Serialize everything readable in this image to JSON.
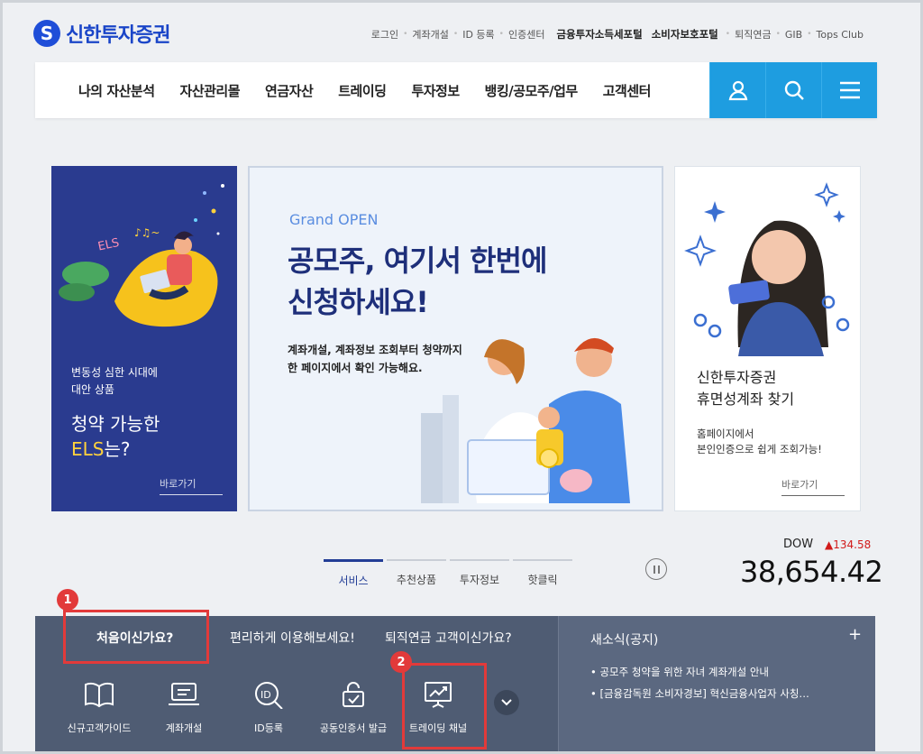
{
  "header": {
    "logo_mark": "S",
    "logo_text": "신한투자증권",
    "util_links": [
      "로그인",
      "계좌개설",
      "ID 등록",
      "인증센터"
    ],
    "util_strong": [
      "금융투자소득세포털",
      "소비자보호포털"
    ],
    "util_extra": [
      "퇴직연금",
      "GIB",
      "Tops Club"
    ]
  },
  "gnb": {
    "menu": [
      "나의 자산분석",
      "자산관리몰",
      "연금자산",
      "트레이딩",
      "투자정보",
      "뱅킹/공모주/업무",
      "고객센터"
    ],
    "icons": [
      "user-icon",
      "search-icon",
      "menu-icon"
    ],
    "accent": "#1e9de0"
  },
  "banners": {
    "left": {
      "sub": [
        "변동성 심한 시대에",
        "대안 상품"
      ],
      "main_line1": "청약 가능한",
      "main_els": "ELS",
      "main_suffix": "는?",
      "link": "바로가기",
      "deco_text": "ELS",
      "bg": "#2a3b8f"
    },
    "center": {
      "open": "Grand OPEN",
      "title": [
        "공모주, 여기서 한번에",
        "신청하세요!"
      ],
      "desc": [
        "계좌개설, 계좌정보 조회부터 청약까지",
        "한 페이지에서 확인 가능해요."
      ]
    },
    "right": {
      "title": [
        "신한투자증권",
        "휴면성계좌 찾기"
      ],
      "desc": [
        "홈페이지에서",
        "본인인증으로 쉽게 조회가능!"
      ],
      "link": "바로가기"
    }
  },
  "tabs": [
    {
      "label": "서비스",
      "active": true
    },
    {
      "label": "추천상품",
      "active": false
    },
    {
      "label": "투자정보",
      "active": false
    },
    {
      "label": "핫클릭",
      "active": false
    }
  ],
  "index": {
    "name": "DOW",
    "change": "▲134.58",
    "value": "38,654.42",
    "up_color": "#d11a1a"
  },
  "panel": {
    "questions": [
      "처음이신가요?",
      "편리하게 이용해보세요!",
      "퇴직연금 고객이신가요?"
    ],
    "services": [
      {
        "icon": "book-icon",
        "label": "신규고객가이드"
      },
      {
        "icon": "laptop-icon",
        "label": "계좌개설"
      },
      {
        "icon": "id-search-icon",
        "label": "ID등록"
      },
      {
        "icon": "certificate-lock-icon",
        "label": "공동인증서 발급"
      },
      {
        "icon": "trading-chart-icon",
        "label": "트레이딩 채널"
      }
    ],
    "more_icon": "chevron-down-icon"
  },
  "news": {
    "title": "새소식(공지)",
    "plus": "+",
    "items": [
      "공모주 청약을 위한 자녀 계좌개설 안내",
      "[금융감독원 소비자경보] 혁신금융사업자 사칭…"
    ]
  },
  "callouts": [
    {
      "number": "1",
      "color": "#e23a3a"
    },
    {
      "number": "2",
      "color": "#e23a3a"
    }
  ]
}
